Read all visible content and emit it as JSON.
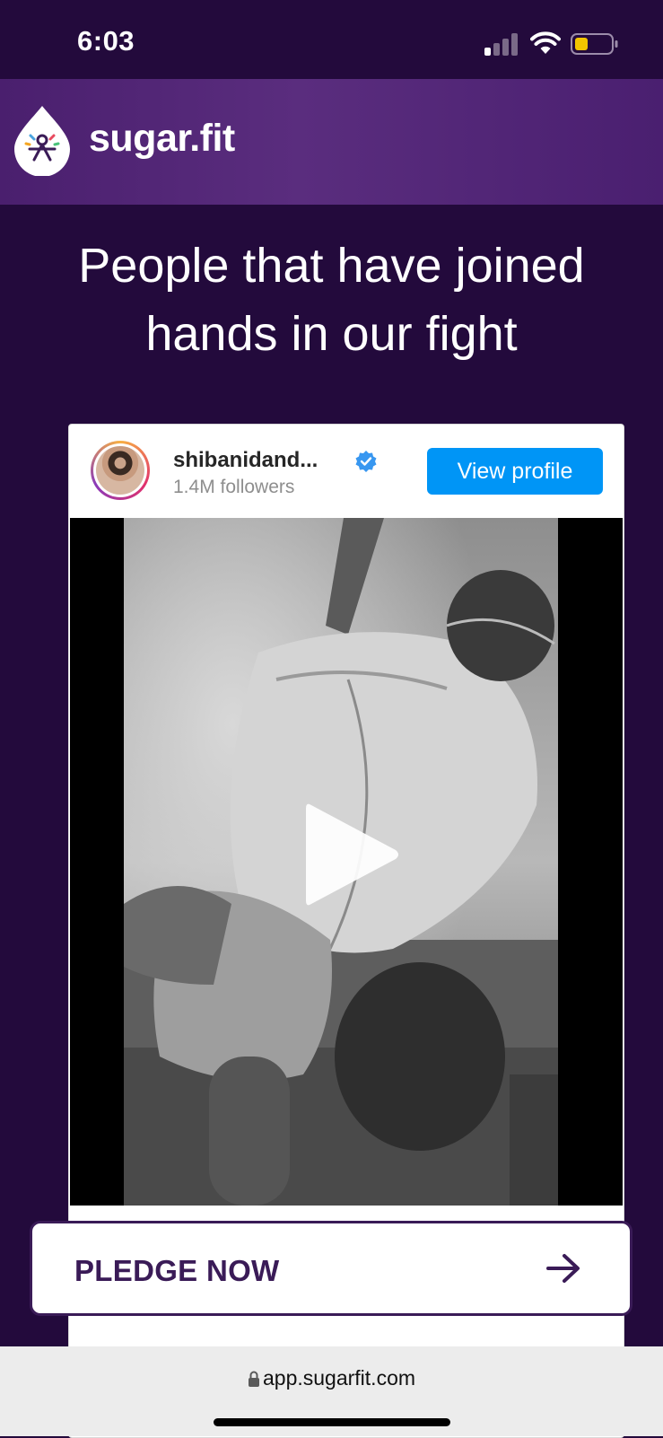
{
  "status_bar": {
    "time": "6:03",
    "signal_bars_active": 1,
    "battery_level_percent": 30
  },
  "header": {
    "brand": "sugar.fit"
  },
  "heading": {
    "line1": "People that have joined",
    "line2": "hands in our fight"
  },
  "embed": {
    "username": "shibanidand...",
    "followers": "1.4M followers",
    "view_profile_label": "View profile",
    "verified": true
  },
  "cta": {
    "pledge_label": "PLEDGE NOW"
  },
  "browser": {
    "url": "app.sugarfit.com"
  },
  "colors": {
    "background": "#230a3c",
    "header": "#4a1f6e",
    "primary_text_on_dark": "#ffffff",
    "cta_text": "#3a1b57",
    "instagram_blue": "#0095f6",
    "battery_low": "#f2c500"
  },
  "icons": [
    "signal-icon",
    "wifi-icon",
    "battery-icon",
    "sugarfit-logo-icon",
    "verified-badge-icon",
    "play-icon",
    "like-icon",
    "comment-icon",
    "share-icon",
    "bookmark-icon",
    "arrow-right-icon",
    "lock-icon"
  ]
}
